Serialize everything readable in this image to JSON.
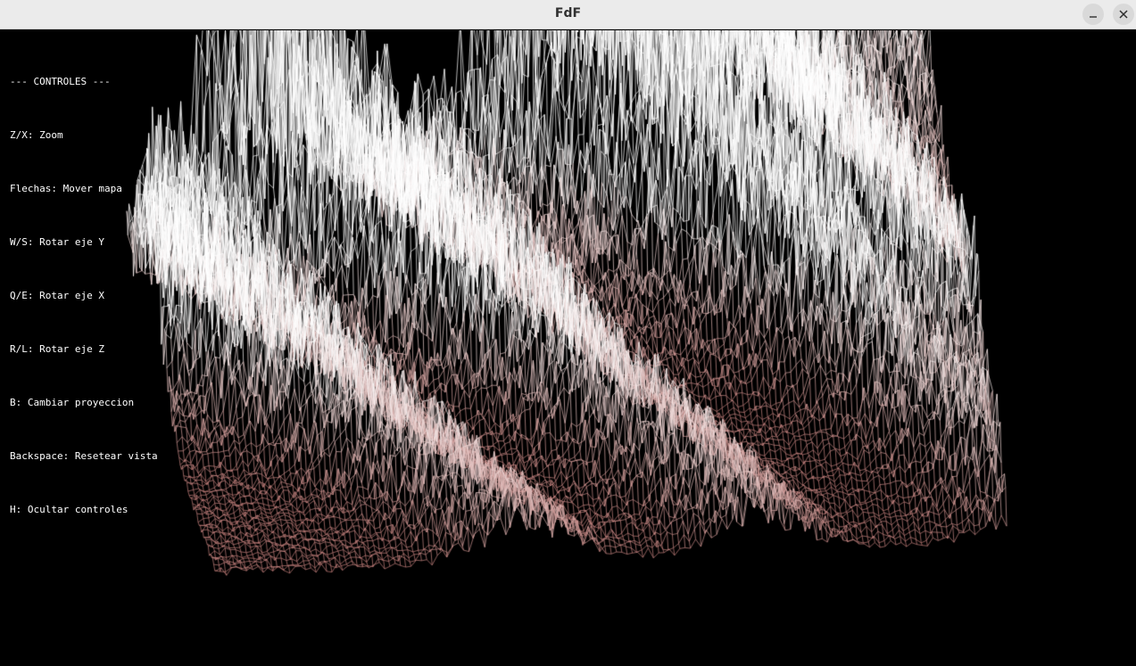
{
  "window": {
    "title": "FdF"
  },
  "controls": {
    "heading": "--- CONTROLES ---",
    "items": [
      "Z/X: Zoom",
      "Flechas: Mover mapa",
      "W/S: Rotar eje Y",
      "Q/E: Rotar eje X",
      "R/L: Rotar eje Z",
      "B: Cambiar proyeccion",
      "Backspace: Resetear vista",
      "H: Ocultar controles"
    ]
  },
  "colors": {
    "background": "#000000",
    "wire_low": "#c47c78",
    "wire_high": "#ffffff",
    "text": "#ffffff",
    "titlebar": "#ebebeb"
  },
  "icons": {
    "minimize": "minimize-icon",
    "close": "close-icon"
  }
}
